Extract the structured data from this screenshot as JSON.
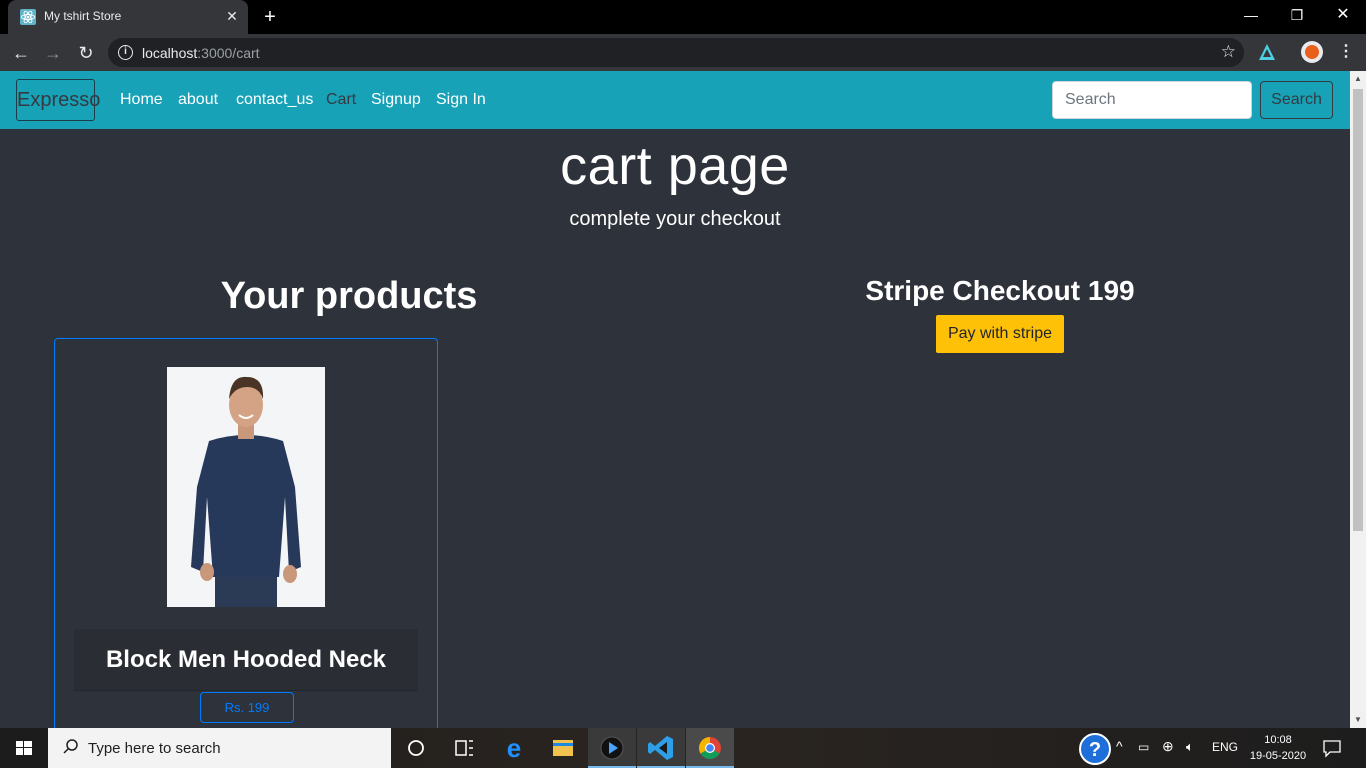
{
  "browser": {
    "tab_title": "My tshirt Store",
    "url_host": "localhost",
    "url_path": ":3000/cart",
    "close_glyph": "✕",
    "new_tab_glyph": "+",
    "minimize_glyph": "—",
    "restore_glyph": "❐",
    "window_close_glyph": "✕",
    "back_glyph": "←",
    "forward_glyph": "→",
    "reload_glyph": "↻",
    "star_glyph": "☆",
    "menu_glyph": "⋮"
  },
  "navbar": {
    "brand": "Expresso",
    "links": [
      "Home",
      "about",
      "contact_us",
      "Cart",
      "Signup",
      "Sign In"
    ],
    "active_link": "Cart",
    "search_placeholder": "Search",
    "search_button": "Search",
    "bg_color": "#17a2b8"
  },
  "hero": {
    "title": "cart page",
    "subtitle": "complete your checkout"
  },
  "products": {
    "heading": "Your products",
    "items": [
      {
        "name": "Block Men Hooded Neck",
        "price": "Rs. 199",
        "image": "man-in-navy-long-sleeve-tshirt"
      }
    ]
  },
  "checkout": {
    "title": "Stripe Checkout 199",
    "button": "Pay with stripe",
    "button_color": "#ffc107"
  },
  "taskbar": {
    "search_placeholder": "Type here to search",
    "language": "ENG",
    "time": "10:08",
    "date": "19-05-2020",
    "icons": [
      "cortana-icon",
      "task-view-icon",
      "edge-icon",
      "file-explorer-icon",
      "media-player-icon",
      "vscode-icon",
      "chrome-icon"
    ]
  }
}
